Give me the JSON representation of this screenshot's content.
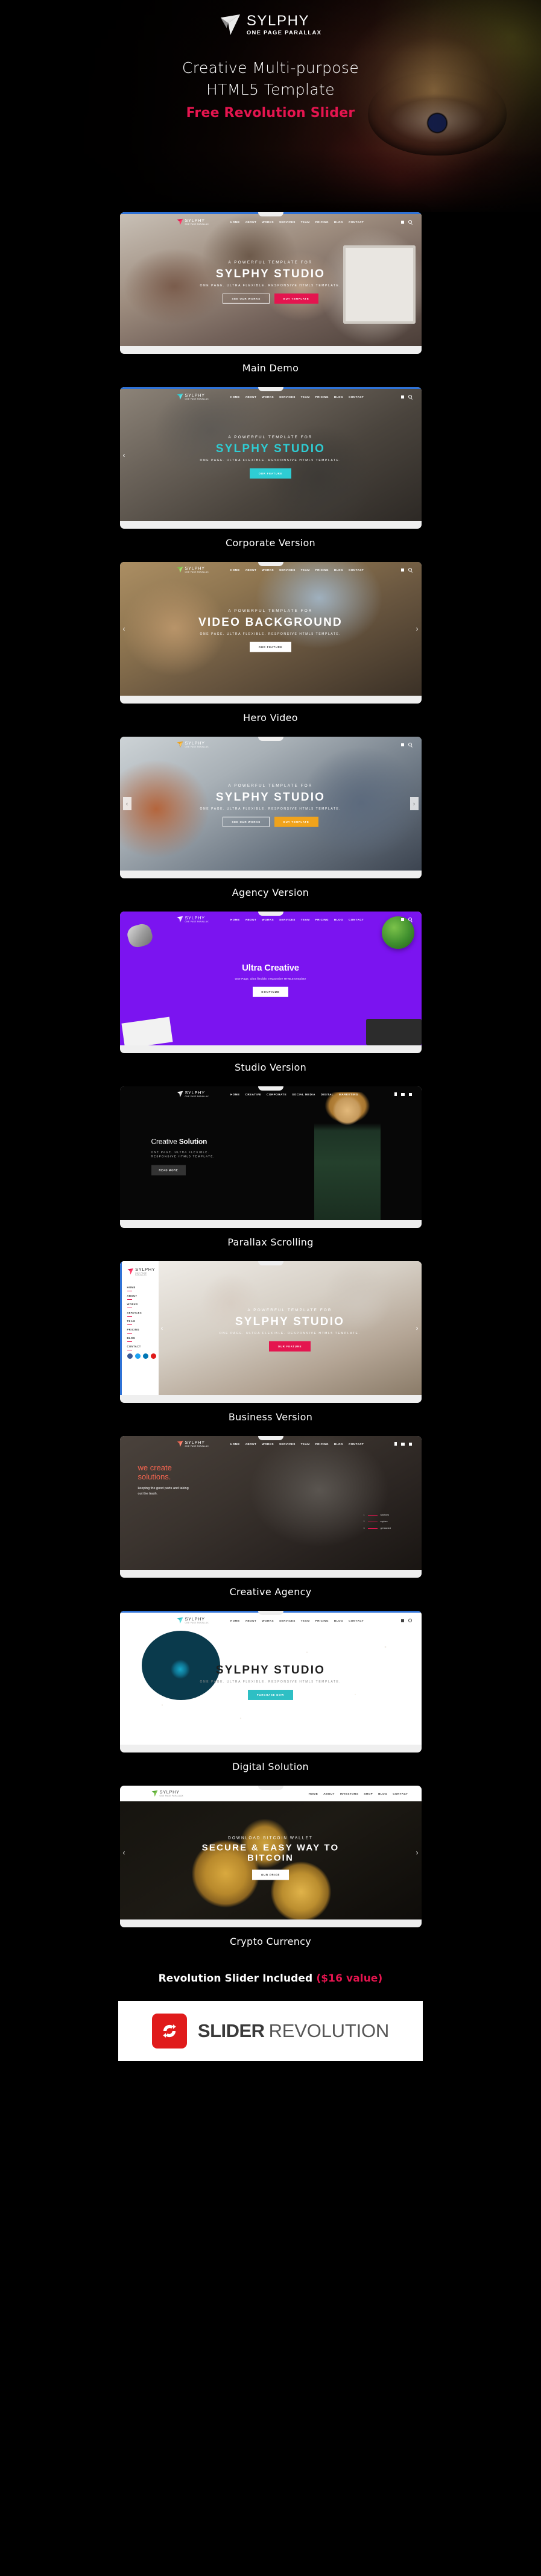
{
  "hero": {
    "logo_name": "SYLPHY",
    "logo_sub": "ONE PAGE PARALLAX",
    "title_line1": "Creative Multi-purpose",
    "title_line2": "HTML5 Template",
    "accent_line": "Free Revolution Slider",
    "accent_color": "#e4154f"
  },
  "demos": [
    {
      "label": "Main Demo",
      "nav": [
        "HOME",
        "ABOUT",
        "WORKS",
        "SERVICES",
        "TEAM",
        "PRICING",
        "BLOG",
        "CONTACT"
      ],
      "eyebrow": "A POWERFUL TEMPLATE FOR",
      "heading": "SYLPHY STUDIO",
      "sub": "ONE PAGE. ULTRA FLEXIBLE. RESPONSIVE HTML5 TEMPLATE.",
      "buttons": [
        "SEE OUR WORKS",
        "BUY TEMPLATE"
      ],
      "accent": "#e4154f"
    },
    {
      "label": "Corporate Version",
      "nav": [
        "HOME",
        "ABOUT",
        "WORKS",
        "SERVICES",
        "TEAM",
        "PRICING",
        "BLOG",
        "CONTACT"
      ],
      "eyebrow": "A POWERFUL TEMPLATE FOR",
      "heading": "SYLPHY STUDIO",
      "sub": "ONE PAGE. ULTRA FLEXIBLE. RESPONSIVE HTML5 TEMPLATE.",
      "buttons": [
        "OUR FEATURE"
      ],
      "accent": "#2ecdd4"
    },
    {
      "label": "Hero Video",
      "nav": [
        "HOME",
        "ABOUT",
        "WORKS",
        "SERVICES",
        "TEAM",
        "PRICING",
        "BLOG",
        "CONTACT"
      ],
      "eyebrow": "A POWERFUL TEMPLATE FOR",
      "heading": "VIDEO BACKGROUND",
      "sub": "ONE PAGE. ULTRA FLEXIBLE. RESPONSIVE HTML5 TEMPLATE.",
      "buttons": [
        "OUR FEATURE"
      ],
      "accent": "#7bc24a"
    },
    {
      "label": "Agency Version",
      "nav": [],
      "eyebrow": "A POWERFUL TEMPLATE FOR",
      "heading": "SYLPHY STUDIO",
      "sub": "ONE PAGE. ULTRA FLEXIBLE. RESPONSIVE HTML5 TEMPLATE.",
      "buttons": [
        "SEE OUR WORKS",
        "BUY TEMPLATE"
      ],
      "accent": "#f0a31c"
    },
    {
      "label": "Studio Version",
      "nav": [
        "HOME",
        "ABOUT",
        "WORKS",
        "SERVICES",
        "TEAM",
        "PRICING",
        "BLOG",
        "CONTACT"
      ],
      "heading": "Ultra Creative",
      "sub": "One Page, ultra flexible, responsive HTML5 template",
      "buttons": [
        "CONTINUE"
      ],
      "accent": "#7b14f0"
    },
    {
      "label": "Parallax Scrolling",
      "nav": [
        "HOME",
        "CREATIVE",
        "CORPORATE",
        "SOCIAL MEDIA",
        "DIGITAL",
        "MARKETING"
      ],
      "heading_light": "Creative ",
      "heading_bold": "Solution",
      "sub_line1": "ONE PAGE. ULTRA FLEXIBLE.",
      "sub_line2": "RESPONSIVE HTML5 TEMPLATE.",
      "buttons": [
        "READ MORE"
      ],
      "accent": "#333333"
    },
    {
      "label": "Business Version",
      "nav": [
        "HOME",
        "ABOUT",
        "WORKS",
        "SERVICES",
        "TEAM",
        "PRICING",
        "BLOG",
        "CONTACT"
      ],
      "eyebrow": "A POWERFUL TEMPLATE FOR",
      "heading": "SYLPHY STUDIO",
      "sub": "ONE PAGE. ULTRA FLEXIBLE. RESPONSIVE HTML5 TEMPLATE.",
      "buttons": [
        "OUR FEATURE"
      ],
      "social": [
        "facebook-icon",
        "twitter-icon",
        "linkedin-icon",
        "youtube-icon"
      ],
      "accent": "#e4154f"
    },
    {
      "label": "Creative Agency",
      "nav": [
        "HOME",
        "ABOUT",
        "WORKS",
        "SERVICES",
        "TEAM",
        "PRICING",
        "BLOG",
        "CONTACT"
      ],
      "heading_line1": "we create",
      "heading_line2": "solutions.",
      "sub_line1": "keeping the good parts and taking",
      "sub_line2": "out the trash.",
      "steps": [
        {
          "num": "1",
          "label": "solutions"
        },
        {
          "num": "2",
          "label": "explore"
        },
        {
          "num": "3",
          "label": "get started"
        }
      ],
      "accent": "#f1644f"
    },
    {
      "label": "Digital Solution",
      "nav": [
        "HOME",
        "ABOUT",
        "WORKS",
        "SERVICES",
        "TEAM",
        "PRICING",
        "BLOG",
        "CONTACT"
      ],
      "heading": "SYLPHY STUDIO",
      "sub": "ONE PAGE. ULTRA FLEXIBLE. RESPONSIVE HTML5 TEMPLATE.",
      "buttons": [
        "PURCHASE NOW"
      ],
      "accent": "#2ebfc4"
    },
    {
      "label": "Crypto Currency",
      "nav": [
        "HOME",
        "ABOUT",
        "INVESTORS",
        "SHOP",
        "BLOG",
        "CONTACT"
      ],
      "eyebrow": "DOWNLOAD BITCOIN WALLET",
      "heading_line1": "SECURE & EASY WAY TO",
      "heading_line2": "BITCOIN",
      "buttons": [
        "OUR PRICE"
      ],
      "accent": "#d9a93f"
    }
  ],
  "footer": {
    "rev_text": "Revolution Slider Included ",
    "rev_value": "($16 value)",
    "logo_bold": "SLIDER",
    "logo_thin": "REVOLUTION",
    "logo_icon_color": "#e01b1b"
  },
  "mini_logo": {
    "name": "SYLPHY",
    "sub": "ONE PAGE PARALLAX"
  }
}
